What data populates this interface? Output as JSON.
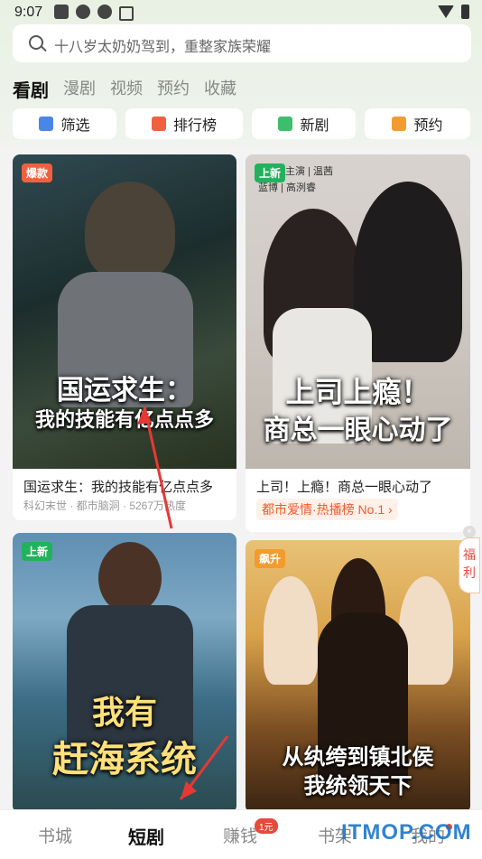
{
  "status_bar": {
    "time": "9:07"
  },
  "search": {
    "placeholder": "十八岁太奶奶驾到，重整家族荣耀"
  },
  "tabs": [
    "看剧",
    "漫剧",
    "视频",
    "预约",
    "收藏"
  ],
  "quick": [
    {
      "label": "筛选",
      "icon": "grid-icon",
      "color": "#4a86e8"
    },
    {
      "label": "排行榜",
      "icon": "bar-chart-icon",
      "color": "#f0603f"
    },
    {
      "label": "新剧",
      "icon": "play-icon",
      "color": "#3cbf6c"
    },
    {
      "label": "预约",
      "icon": "calendar-check-icon",
      "color": "#f29b2e"
    }
  ],
  "cards": [
    {
      "badge": "爆款",
      "badge_color": "#f0603f",
      "poster_title_1": "国运求生：",
      "poster_title_2": "我的技能有亿点点多",
      "title": "国运求生：我的技能有亿点点多",
      "subtitle": "科幻末世 · 都市脑洞 · 5267万热度"
    },
    {
      "badge": "上新",
      "badge_color": "#22b15d",
      "poster_credit_1": "主演 | 温茜",
      "poster_credit_2": "蓝博 | 高洌睿",
      "poster_title_1": "上司上瘾！",
      "poster_title_2": "商总一眼心动了",
      "title": "上司！上瘾！商总一眼心动了",
      "rank_label": "都市爱情·热播榜 No.1 ›"
    },
    {
      "badge": "上新",
      "badge_color": "#22b15d",
      "poster_title_1": "我有",
      "poster_title_2": "赶海系统"
    },
    {
      "badge": "飙升",
      "badge_color": "#f29b2e",
      "poster_title_1": "从纨绔到镇北侯",
      "poster_title_2": "我统领天下"
    }
  ],
  "floating": {
    "fuli_label": "福利"
  },
  "bottom_nav": [
    {
      "label": "书城",
      "active": false
    },
    {
      "label": "短剧",
      "active": true
    },
    {
      "label": "赚钱",
      "active": false,
      "badge": "1元"
    },
    {
      "label": "书架",
      "active": false
    },
    {
      "label": "我的",
      "active": false
    }
  ],
  "watermark": "ITMOP.COM"
}
